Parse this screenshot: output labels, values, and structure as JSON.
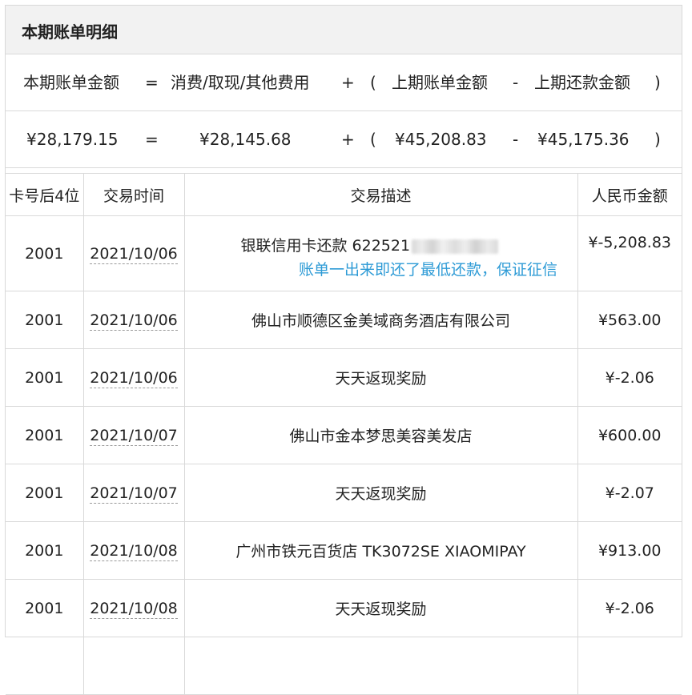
{
  "section": {
    "title": "本期账单明细"
  },
  "formula": {
    "labels": {
      "current_amount": "本期账单金额",
      "eq": "=",
      "spend": "消费/取现/其他费用",
      "plus": "+",
      "lparen": "(",
      "prev_amount": "上期账单金额",
      "minus": "-",
      "prev_repaid": "上期还款金额",
      "rparen": ")"
    },
    "values": {
      "current_amount": "¥28,179.15",
      "eq": "=",
      "spend": "¥28,145.68",
      "plus": "+",
      "lparen": "(",
      "prev_amount": "¥45,208.83",
      "minus": "-",
      "prev_repaid": "¥45,175.36",
      "rparen": ")"
    }
  },
  "table": {
    "headers": {
      "card": "卡号后4位",
      "date": "交易时间",
      "desc": "交易描述",
      "amount": "人民币金额"
    },
    "rows": [
      {
        "card": "2001",
        "date": "2021/10/06",
        "desc": "银联信用卡还款 622521",
        "amount": "¥-5,208.83"
      },
      {
        "card": "2001",
        "date": "2021/10/06",
        "desc": "佛山市顺德区金美域商务酒店有限公司",
        "amount": "¥563.00"
      },
      {
        "card": "2001",
        "date": "2021/10/06",
        "desc": "天天返现奖励",
        "amount": "¥-2.06"
      },
      {
        "card": "2001",
        "date": "2021/10/07",
        "desc": "佛山市金本梦思美容美发店",
        "amount": "¥600.00"
      },
      {
        "card": "2001",
        "date": "2021/10/07",
        "desc": "天天返现奖励",
        "amount": "¥-2.07"
      },
      {
        "card": "2001",
        "date": "2021/10/08",
        "desc": "广州市铁元百货店 TK3072SE XIAOMIPAY",
        "amount": "¥913.00"
      },
      {
        "card": "2001",
        "date": "2021/10/08",
        "desc": "天天返现奖励",
        "amount": "¥-2.06"
      }
    ]
  },
  "annotation": {
    "text": "账单一出来即还了最低还款，保证征信",
    "color": "#2e9bd6"
  }
}
